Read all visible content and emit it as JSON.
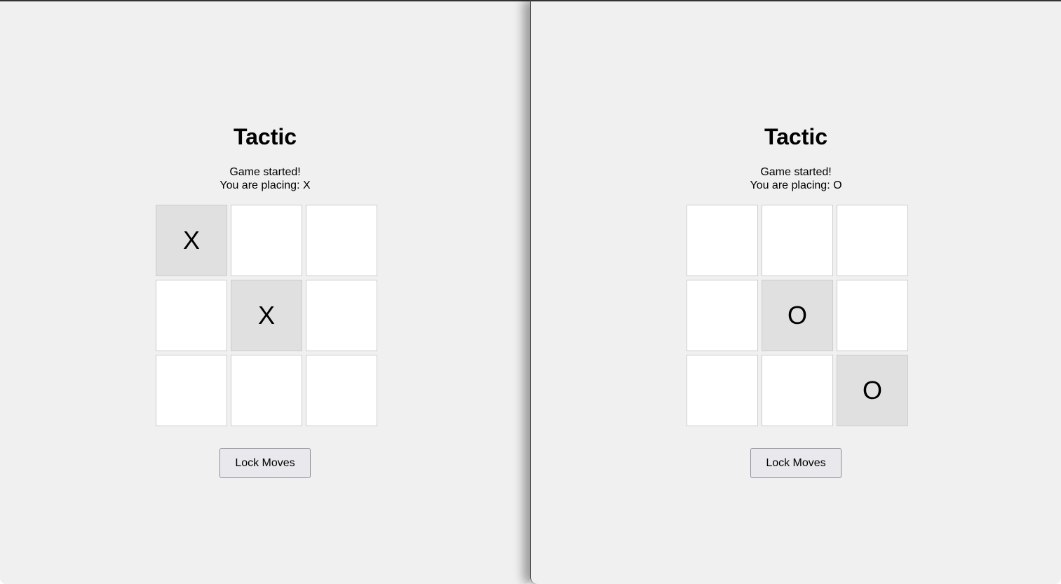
{
  "windows": [
    {
      "title": "Tactic",
      "status_line1": "Game started!",
      "status_line2": "You are placing: X",
      "board": [
        "X",
        "",
        "",
        "",
        "X",
        "",
        "",
        "",
        ""
      ],
      "lock_button_label": "Lock Moves"
    },
    {
      "title": "Tactic",
      "status_line1": "Game started!",
      "status_line2": "You are placing: O",
      "board": [
        "",
        "",
        "",
        "",
        "O",
        "",
        "",
        "",
        "O"
      ],
      "lock_button_label": "Lock Moves"
    }
  ],
  "colors": {
    "page_background": "#f0f0f0",
    "empty_cell": "#ffffff",
    "filled_cell": "#e0e0e0",
    "cell_border": "#cccccc",
    "button_background": "#e9e9ed"
  }
}
